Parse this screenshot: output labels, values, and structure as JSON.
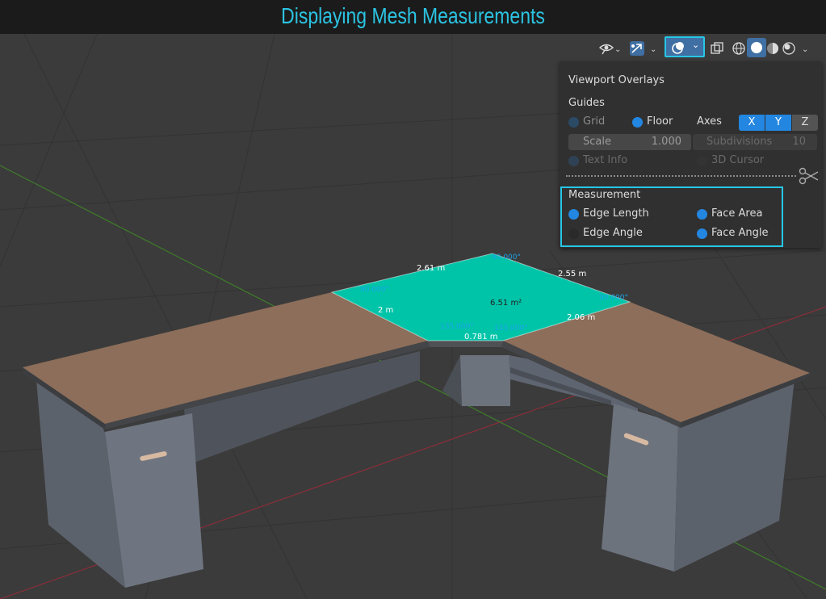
{
  "title": "Displaying Mesh Measurements",
  "measurements": {
    "edge_top_left": "2.61 m",
    "edge_top_right": "2.55 m",
    "edge_left": "2 m",
    "edge_right": "2.06 m",
    "edge_bottom": "0.781 m",
    "face_area": "6.51 m²",
    "angle_top": "90.000°",
    "angle_left": "90.000°",
    "angle_right": "90.000°",
    "angle_bottom_left": "135.000°",
    "angle_bottom_right": "135.000°"
  },
  "panel": {
    "title": "Viewport Overlays",
    "guides_label": "Guides",
    "grid_label": "Grid",
    "floor_label": "Floor",
    "axes_label": "Axes",
    "axis_x": "X",
    "axis_y": "Y",
    "axis_z": "Z",
    "scale_label": "Scale",
    "scale_value": "1.000",
    "subdivisions_label": "Subdivisions",
    "subdivisions_value": "10",
    "text_info_label": "Text Info",
    "cursor_label": "3D Cursor",
    "measurement_label": "Measurement",
    "edge_length_label": "Edge Length",
    "face_area_label": "Face Area",
    "edge_angle_label": "Edge Angle",
    "face_angle_label": "Face Angle"
  },
  "toolbar_icons": [
    "visibility-icon",
    "gizmo-icon",
    "overlays-icon",
    "xray-icon",
    "wireframe-shading-icon",
    "solid-shading-icon",
    "material-shading-icon",
    "rendered-shading-icon"
  ],
  "colors": {
    "accent": "#27c6e6",
    "selected_face": "#00c4a8",
    "toggle_on": "#2386e0"
  }
}
